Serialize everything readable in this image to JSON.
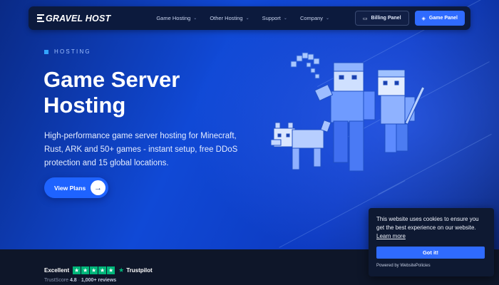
{
  "brand": {
    "logo_text": "GRAVEL HOST"
  },
  "nav": {
    "menu": [
      {
        "label": "Game Hosting"
      },
      {
        "label": "Other Hosting"
      },
      {
        "label": "Support"
      },
      {
        "label": "Company"
      }
    ],
    "billing_label": "Billing Panel",
    "game_panel_label": "Game Panel"
  },
  "hero": {
    "eyebrow": "HOSTING",
    "title_line1": "Game Server",
    "title_line2": "Hosting",
    "description": "High-performance game server hosting for Minecraft, Rust, ARK and 50+ games - instant setup, free DDoS protection and 15 global locations.",
    "cta_label": "View Plans"
  },
  "trustpilot": {
    "rating_word": "Excellent",
    "brand": "Trustpilot",
    "score_prefix": "TrustScore",
    "score": "4.8",
    "reviews": "1,000+ reviews",
    "stars": 5
  },
  "cookie": {
    "message": "This website uses cookies to ensure you get the best experience on our website.",
    "learn_more": "Learn more",
    "accept_label": "Got it!",
    "powered_by": "Powered by WebsitePolicies"
  },
  "colors": {
    "accent": "#2f6bff",
    "nav_bg": "#0c1a3d",
    "trustpilot_green": "#00b67a"
  }
}
